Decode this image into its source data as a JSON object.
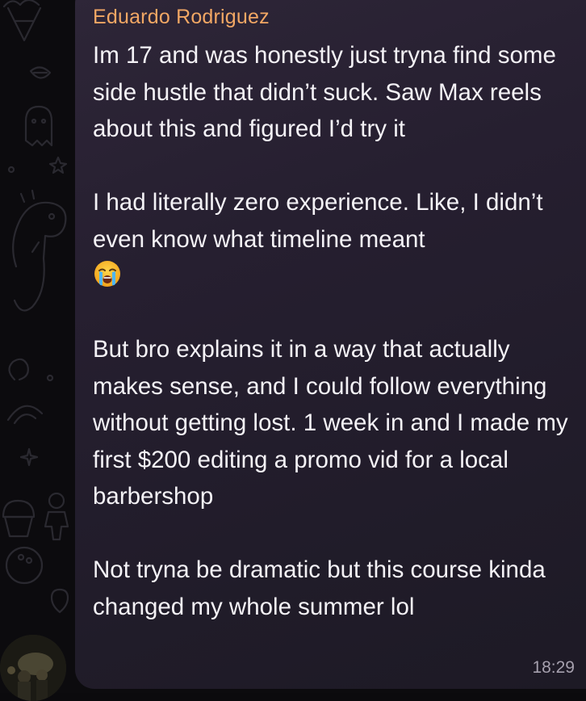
{
  "message": {
    "sender": "Eduardo Rodriguez",
    "sender_color": "#f2a764",
    "paragraph_1": "Im 17 and was honestly just tryna find some side hustle that didn’t suck. Saw Max reels about this and figured I’d try it",
    "paragraph_2": "I had literally zero experience. Like, I didn’t even know what timeline meant",
    "paragraph_2_emoji": "loudly-crying-face-icon",
    "paragraph_3": "But bro explains it in a way that actually makes sense, and I could follow everything without getting lost. 1 week in and I made my first $200 editing a promo vid for a local barbershop",
    "paragraph_4": "Not tryna be dramatic but this course kinda changed my whole summer lol",
    "time": "18:29"
  },
  "theme": {
    "bubble_color": "#261f30",
    "background_color": "#0c0b0e",
    "text_color": "#f4f2f6",
    "time_color": "#a6a0ae"
  },
  "icons": {
    "avatar": "avatar",
    "background": "doodle-pattern"
  }
}
